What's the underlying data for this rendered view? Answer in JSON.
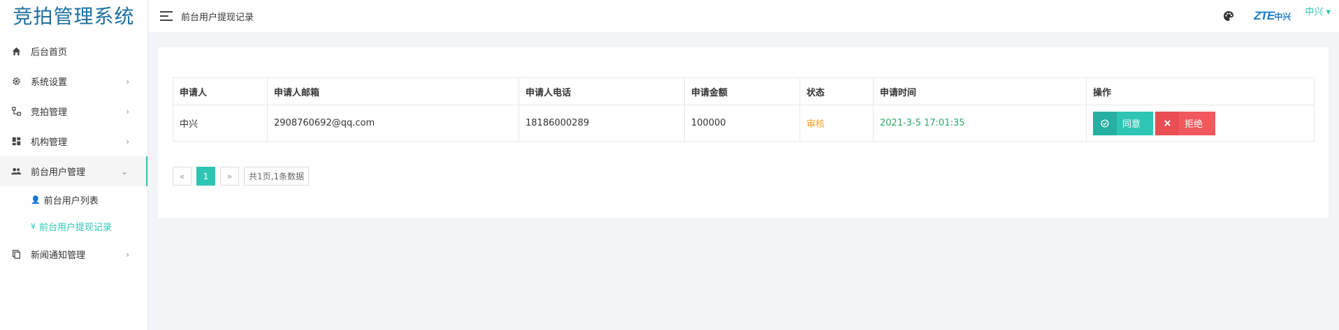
{
  "app_title": "竞拍管理系统",
  "sidebar": {
    "items": [
      {
        "label": "后台首页",
        "icon": "home-icon"
      },
      {
        "label": "系统设置",
        "icon": "gear-icon"
      },
      {
        "label": "竞拍管理",
        "icon": "sitemap-icon"
      },
      {
        "label": "机构管理",
        "icon": "dashboard-icon"
      },
      {
        "label": "前台用户管理",
        "icon": "users-icon"
      },
      {
        "label": "新闻通知管理",
        "icon": "copy-icon"
      }
    ],
    "submenu": [
      {
        "label": "前台用户列表",
        "icon": "👤"
      },
      {
        "label": "前台用户提现记录",
        "icon": "¥"
      }
    ]
  },
  "header": {
    "breadcrumb": "前台用户提现记录",
    "brand_logo": "ZTE中兴",
    "brand_logo_zte": "ZTE",
    "brand_logo_cn": "中兴",
    "user": "中兴 ▾"
  },
  "table": {
    "headers": [
      "申请人",
      "申请人邮箱",
      "申请人电话",
      "申请金额",
      "状态",
      "申请时间",
      "操作"
    ],
    "rows": [
      {
        "applicant": "中兴",
        "email": "2908760692@qq.com",
        "phone": "18186000289",
        "amount": "100000",
        "status": "审核",
        "time": "2021-3-5 17:01:35"
      }
    ],
    "actions": {
      "agree": "同意",
      "reject": "拒绝"
    }
  },
  "pagination": {
    "prev": "«",
    "current": "1",
    "next": "»",
    "info": "共1页,1条数据"
  },
  "colors": {
    "accent": "#2ec5b4",
    "reject": "#f0585d",
    "status": "#f0a020",
    "time": "#2aa868",
    "logo": "#1b6fa0"
  }
}
